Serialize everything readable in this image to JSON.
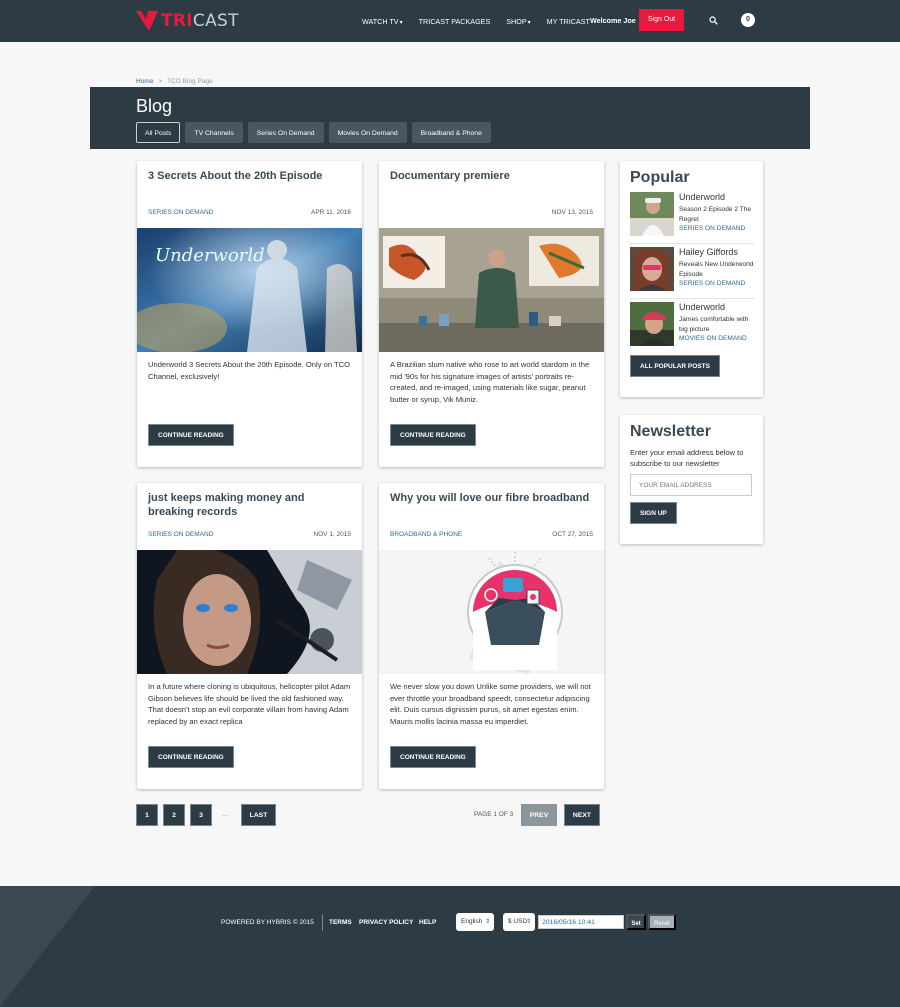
{
  "header": {
    "logo_strong": "TRI",
    "logo_light": "CAST",
    "nav": [
      {
        "label": "WATCH TV",
        "has_caret": true
      },
      {
        "label": "TRICAST PACKAGES",
        "has_caret": false
      },
      {
        "label": "SHOP",
        "has_caret": true
      },
      {
        "label": "MY TRICAST",
        "has_caret": false
      }
    ],
    "caret": "▾",
    "welcome": "Welcome Joe",
    "signout": "Sign Out",
    "cart_count": "0",
    "search_icon": "search-icon",
    "brand_color": "#e8193c",
    "bar_color": "#2d3b45"
  },
  "breadcrumb": {
    "home": "Home",
    "separator": ">",
    "current": "TCO Blog Page"
  },
  "blog": {
    "title": "Blog",
    "filters": [
      "All Posts",
      "TV Channels",
      "Series On Demand",
      "Movies On Demand",
      "Broadband & Phone"
    ],
    "active_filter": "All Posts"
  },
  "posts": [
    {
      "title": "3 Secrets About the 20th Episode",
      "category": "SERIES ON DEMAND",
      "date": "APR 11, 2016",
      "image_text": "Underworld",
      "excerpt": "Underworld 3 Secrets About the 20th Episode. Only on TCO Channel, exclusively!",
      "button": "CONTINUE READING"
    },
    {
      "title": "Documentary premiere",
      "category": "",
      "date": "NOV 13, 2015",
      "image_text": "",
      "excerpt": "A Brazilian slum native who rose to art world stardom in the mid '90s for his signature images of artists' portraits re-created, and re-imaged, using materials like sugar, peanut butter or syrup, Vik Muniz.",
      "button": "CONTINUE READING"
    },
    {
      "title": "just keeps making money and breaking records",
      "category": "SERIES ON DEMAND",
      "date": "NOV 1, 2015",
      "image_text": "",
      "excerpt": "In a future where cloning is ubiquitous, helicopter pilot Adam Gibson believes life should be lived the old fashioned way. That doesn't stop an evil corporate villain from having Adam replaced by an exact replica",
      "button": "CONTINUE READING"
    },
    {
      "title": "Why you will love our fibre broadband",
      "category": "BROADBAND & PHONE",
      "date": "OCT 27, 2015",
      "image_text": "",
      "excerpt": "We never slow you down Unlike some providers, we will not ever throttle your broadband speedt, consectetur adipiscing elit. Duis cursus dignissim purus, sit amet egestas enim. Mauris mollis lacinia massa eu imperdiet.",
      "button": "CONTINUE READING"
    }
  ],
  "popular": {
    "title": "Popular",
    "items": [
      {
        "name": "Underworld",
        "desc": "Season 2 Episode 2 The Regret",
        "category": "SERIES ON DEMAND"
      },
      {
        "name": "Hailey Giffords",
        "desc": "Reveals New Underworld Episode",
        "category": "SERIES ON DEMAND"
      },
      {
        "name": "Underworld",
        "desc": "James comfortable with big picture",
        "category": "MOVIES ON DEMAND"
      }
    ],
    "button": "ALL POPULAR POSTS"
  },
  "newsletter": {
    "title": "Newsletter",
    "text": "Enter your email address below to subscribe to our newsletter",
    "placeholder": "YOUR EMAIL ADDRESS",
    "button": "SIGN UP"
  },
  "pagination": {
    "pages": [
      "1",
      "2",
      "3"
    ],
    "dots": "...",
    "last": "LAST",
    "info": "PAGE 1 OF 3",
    "prev": "PREV",
    "next": "NEXT"
  },
  "footer": {
    "powered": "POWERED BY HYBRIS © 2015",
    "links": [
      "TERMS",
      "PRIVACY POLICY",
      "HELP"
    ],
    "language": "English",
    "currency": "$ USD",
    "datetime": "2016/05/16 10:41",
    "set": "Set",
    "reset": "Reset"
  }
}
